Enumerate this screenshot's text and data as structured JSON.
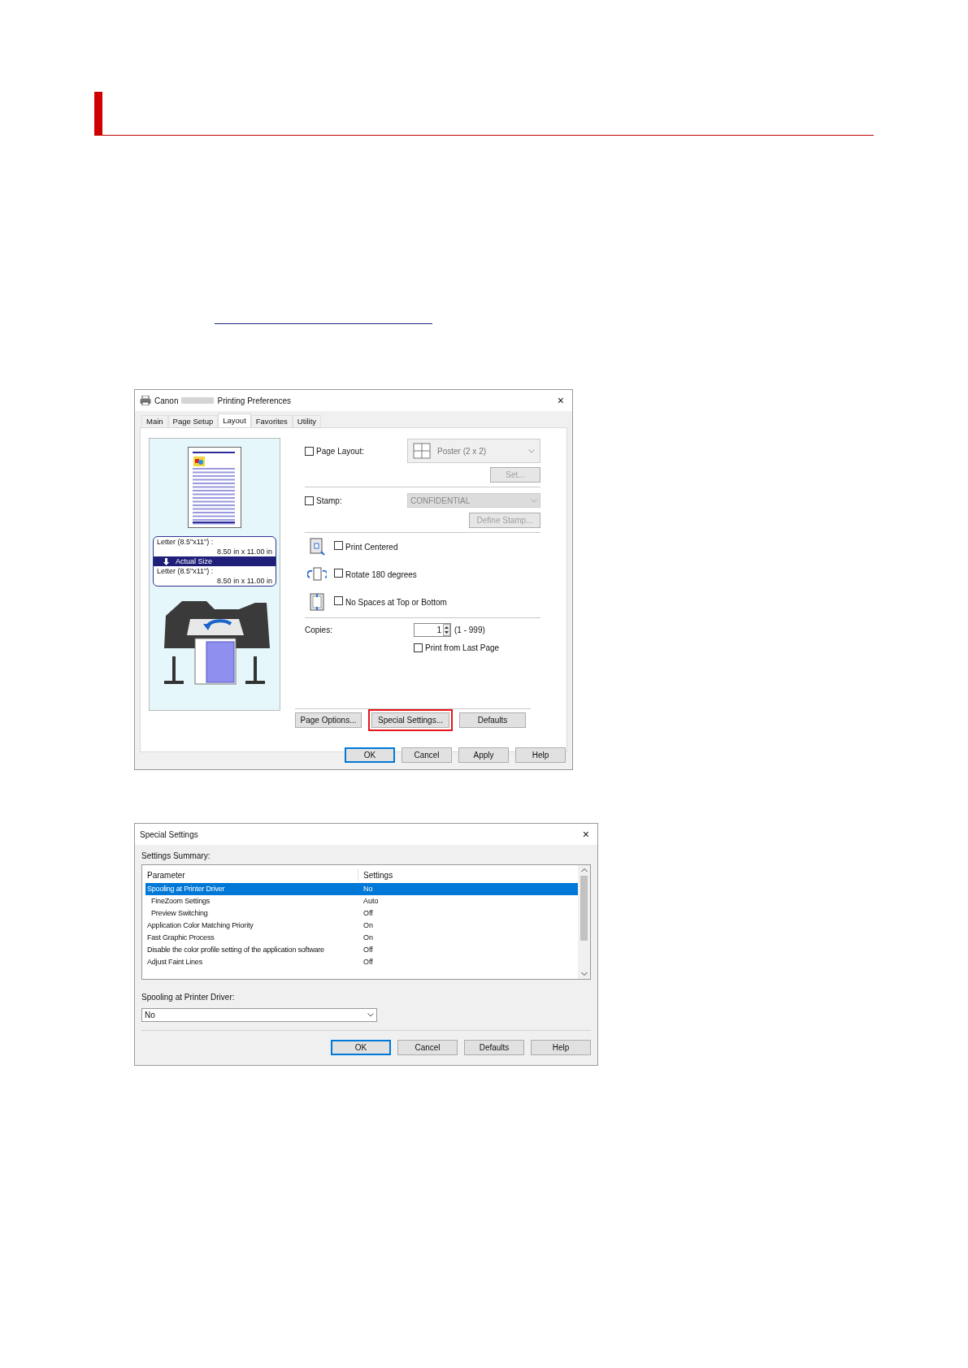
{
  "printing_preferences": {
    "close_glyph": "×",
    "title_brand": "Canon",
    "title_rest": "Printing Preferences",
    "tabs": [
      {
        "label": "Main",
        "selected": false
      },
      {
        "label": "Page Setup",
        "selected": false
      },
      {
        "label": "Layout",
        "selected": true
      },
      {
        "label": "Favorites",
        "selected": false
      },
      {
        "label": "Utility",
        "selected": false
      }
    ],
    "preview": {
      "input_size": "Letter (8.5\"x11\") :",
      "input_dims": "8.50 in x 11.00 in",
      "mode": "Actual Size",
      "output_size": "Letter (8.5\"x11\") :",
      "output_dims": "8.50 in x 11.00 in"
    },
    "page_layout": {
      "label": "Page Layout:",
      "checked": false,
      "value": "Poster (2 x 2)",
      "disabled": true,
      "button": "Set...",
      "button_disabled": true
    },
    "stamp": {
      "label": "Stamp:",
      "checked": false,
      "value": "CONFIDENTIAL",
      "disabled": true,
      "button": "Define Stamp...",
      "button_disabled": true
    },
    "options": [
      {
        "kind": "centered",
        "label": "Print Centered",
        "checked": false
      },
      {
        "kind": "rotate",
        "label": "Rotate 180 degrees",
        "checked": false
      },
      {
        "kind": "nospaces",
        "label": "No Spaces at Top or Bottom",
        "checked": false
      }
    ],
    "copies": {
      "label": "Copies:",
      "value": "1",
      "range": "(1 - 999)",
      "last_page_label": "Print from Last Page",
      "last_page_checked": false
    },
    "panel_buttons": [
      {
        "label": "Page Options...",
        "highlighted": false
      },
      {
        "label": "Special Settings...",
        "highlighted": true
      },
      {
        "label": "Defaults",
        "highlighted": false
      }
    ],
    "buttons": [
      {
        "label": "OK",
        "default": true
      },
      {
        "label": "Cancel",
        "default": false
      },
      {
        "label": "Apply",
        "default": false
      },
      {
        "label": "Help",
        "default": false
      }
    ]
  },
  "special_settings": {
    "close_glyph": "×",
    "title": "Special Settings",
    "summary_label": "Settings Summary:",
    "columns": [
      "Parameter",
      "Settings"
    ],
    "rows": [
      {
        "parameter": "Spooling at Printer Driver",
        "setting": "No",
        "selected": true,
        "children": [
          {
            "parameter": "FineZoom Settings",
            "setting": "Auto",
            "selected": false
          },
          {
            "parameter": "Preview Switching",
            "setting": "Off",
            "selected": false
          }
        ]
      },
      {
        "parameter": "Application Color Matching Priority",
        "setting": "On",
        "selected": false
      },
      {
        "parameter": "Fast Graphic Process",
        "setting": "On",
        "selected": false
      },
      {
        "parameter": "Disable the color profile setting of the application software",
        "setting": "Off",
        "selected": false
      },
      {
        "parameter": "Adjust Faint Lines",
        "setting": "Off",
        "selected": false
      }
    ],
    "field_label": "Spooling at Printer Driver:",
    "field_value": "No",
    "buttons": [
      {
        "label": "OK",
        "default": true
      },
      {
        "label": "Cancel",
        "default": false
      },
      {
        "label": "Defaults",
        "default": false
      },
      {
        "label": "Help",
        "default": false
      }
    ]
  }
}
